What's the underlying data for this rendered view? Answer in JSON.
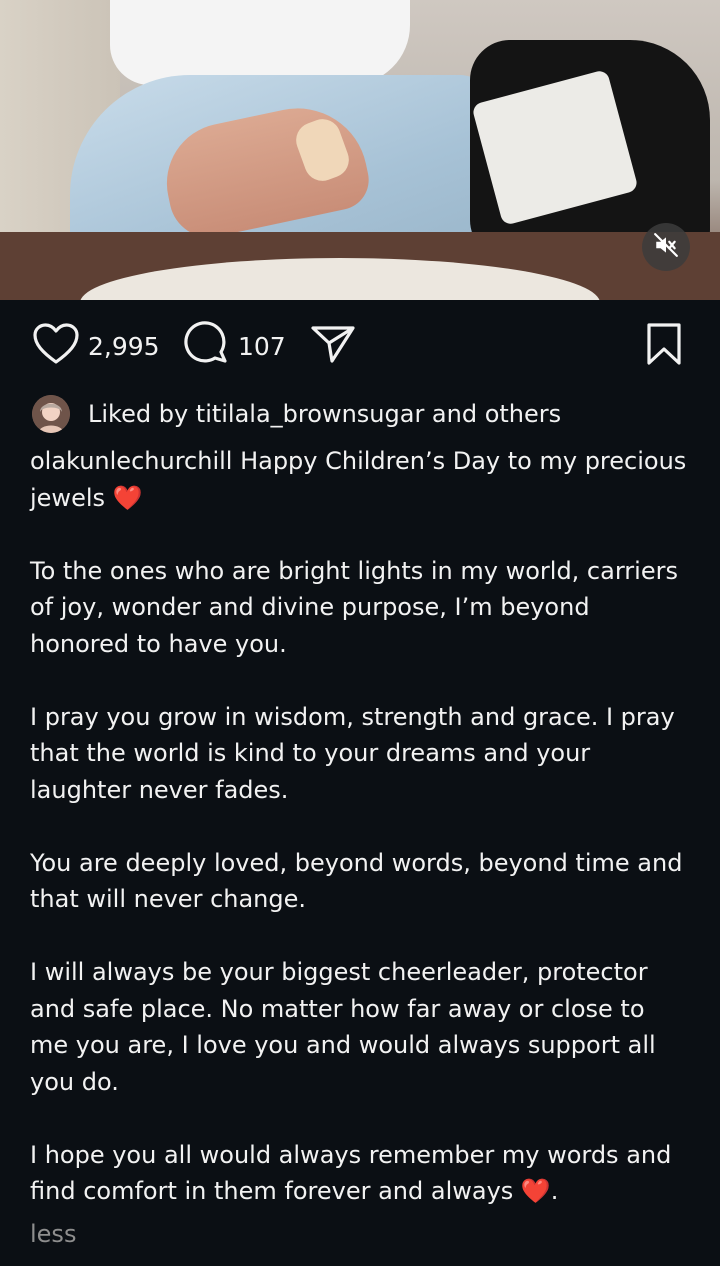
{
  "post": {
    "likes_count": "2,995",
    "comments_count": "107",
    "liked_by_text": "Liked by titilala_brownsugar and others",
    "caption": {
      "line1": "olakunlechurchill Happy Children’s Day to my precious jewels ❤️",
      "p1": "To the ones who are bright lights in my world, carriers of joy, wonder and divine purpose, I’m beyond honored to have you.",
      "p2": "I pray you grow in wisdom, strength and grace. I pray that the world is kind to your dreams and your laughter never fades.",
      "p3": "You are deeply loved, beyond words, beyond time and that will never change.",
      "p4": "I will always be your biggest cheerleader, protector and safe place. No matter how far away or close to me you are, I love you and would always support all you do.",
      "p5": "I hope you all would always remember my words and find comfort in them forever and always ❤️."
    },
    "less_label": "less"
  },
  "icons": {
    "like": "heart-outline",
    "comment": "speech-bubble",
    "share": "paper-plane",
    "save": "bookmark",
    "mute": "speaker-muted"
  },
  "colors": {
    "background": "#0b0f14",
    "text": "#f2f2f2",
    "muted_text": "#8e8e8e",
    "heart_emoji": "#e0252d"
  }
}
